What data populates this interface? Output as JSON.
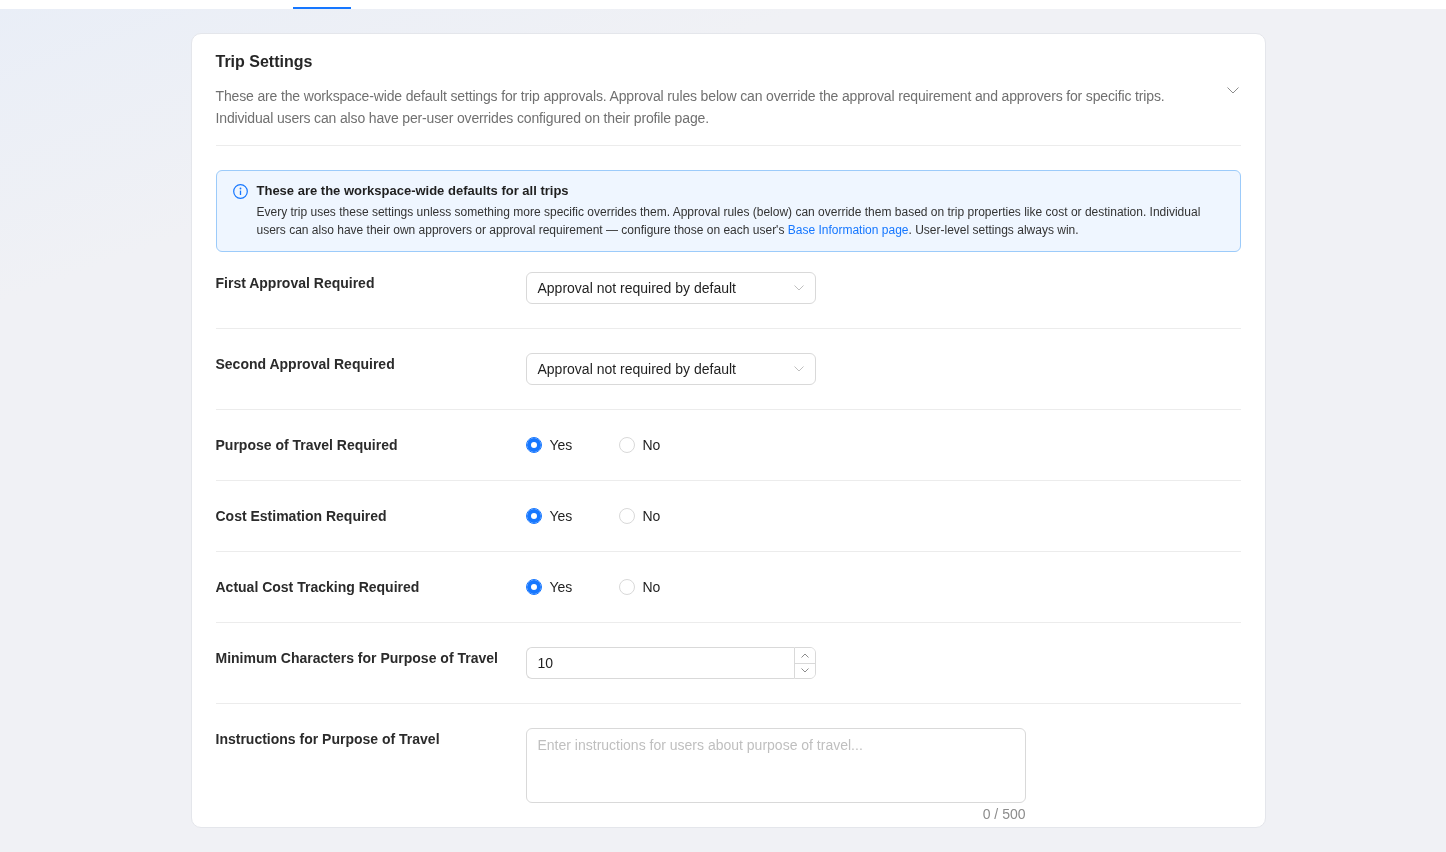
{
  "section": {
    "title": "Trip Settings",
    "description": "These are the workspace-wide default settings for trip approvals. Approval rules below can override the approval requirement and approvers for specific trips. Individual users can also have per-user overrides configured on their profile page."
  },
  "notice": {
    "title": "These are the workspace-wide defaults for all trips",
    "text": "Every trip uses these settings unless something more specific overrides them. Approval rules (below) can override them based on trip properties like cost or destination. Individual users can also have their own approvers or approval requirement — configure those on each user's ",
    "link": "Base Information page",
    "text_end": ". User-level settings always win."
  },
  "settings": [
    {
      "kind": "select",
      "label": "First Approval Required",
      "value": "Approval not required by default"
    },
    {
      "kind": "select",
      "label": "Second Approval Required",
      "value": "Approval not required by default"
    },
    {
      "kind": "radio",
      "label": "Purpose of Travel Required",
      "options": [
        {
          "label": "Yes",
          "selected": true
        },
        {
          "label": "No",
          "selected": false
        }
      ]
    },
    {
      "kind": "radio",
      "label": "Cost Estimation Required",
      "options": [
        {
          "label": "Yes",
          "selected": true
        },
        {
          "label": "No",
          "selected": false
        }
      ]
    },
    {
      "kind": "radio",
      "label": "Actual Cost Tracking Required",
      "options": [
        {
          "label": "Yes",
          "selected": true
        },
        {
          "label": "No",
          "selected": false
        }
      ]
    },
    {
      "kind": "number",
      "label": "Minimum Characters for Purpose of Travel",
      "value": "10"
    },
    {
      "kind": "textarea",
      "label": "Instructions for Purpose of Travel",
      "placeholder": "Enter instructions for users about purpose of travel...",
      "counter": "0 / 500"
    }
  ]
}
